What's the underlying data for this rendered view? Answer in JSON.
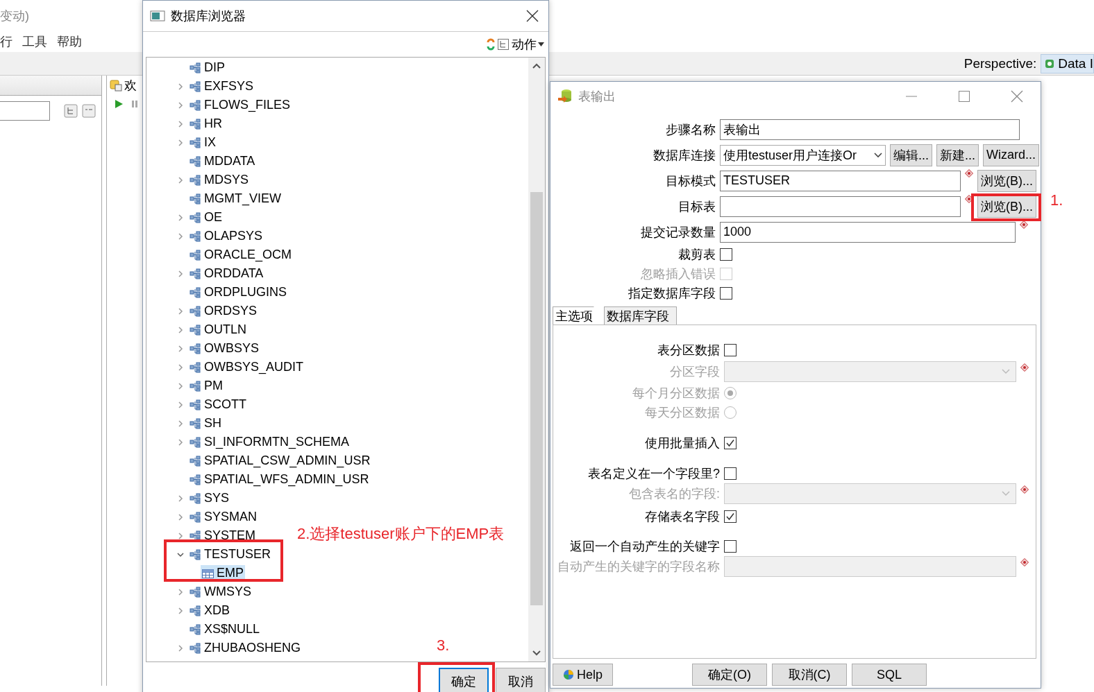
{
  "background_app": {
    "title": "变动)",
    "menu": [
      "行",
      "工具",
      "帮助"
    ],
    "perspective_label": "Perspective:",
    "perspective": "Data I",
    "welcome_tab": "欢"
  },
  "db_browser": {
    "title": "数据库浏览器",
    "action_menu": "动作",
    "tree": [
      {
        "label": "DIP",
        "kind": "schema",
        "expandable": false,
        "selected": false
      },
      {
        "label": "EXFSYS",
        "kind": "schema",
        "expandable": true,
        "expanded": false,
        "selected": false
      },
      {
        "label": "FLOWS_FILES",
        "kind": "schema",
        "expandable": true,
        "expanded": false,
        "selected": false
      },
      {
        "label": "HR",
        "kind": "schema",
        "expandable": true,
        "expanded": false,
        "selected": false
      },
      {
        "label": "IX",
        "kind": "schema",
        "expandable": true,
        "expanded": false,
        "selected": false
      },
      {
        "label": "MDDATA",
        "kind": "schema",
        "expandable": false,
        "selected": false
      },
      {
        "label": "MDSYS",
        "kind": "schema",
        "expandable": true,
        "expanded": false,
        "selected": false
      },
      {
        "label": "MGMT_VIEW",
        "kind": "schema",
        "expandable": false,
        "selected": false
      },
      {
        "label": "OE",
        "kind": "schema",
        "expandable": true,
        "expanded": false,
        "selected": false
      },
      {
        "label": "OLAPSYS",
        "kind": "schema",
        "expandable": true,
        "expanded": false,
        "selected": false
      },
      {
        "label": "ORACLE_OCM",
        "kind": "schema",
        "expandable": false,
        "selected": false
      },
      {
        "label": "ORDDATA",
        "kind": "schema",
        "expandable": true,
        "expanded": false,
        "selected": false
      },
      {
        "label": "ORDPLUGINS",
        "kind": "schema",
        "expandable": false,
        "selected": false
      },
      {
        "label": "ORDSYS",
        "kind": "schema",
        "expandable": true,
        "expanded": false,
        "selected": false
      },
      {
        "label": "OUTLN",
        "kind": "schema",
        "expandable": true,
        "expanded": false,
        "selected": false
      },
      {
        "label": "OWBSYS",
        "kind": "schema",
        "expandable": true,
        "expanded": false,
        "selected": false
      },
      {
        "label": "OWBSYS_AUDIT",
        "kind": "schema",
        "expandable": true,
        "expanded": false,
        "selected": false
      },
      {
        "label": "PM",
        "kind": "schema",
        "expandable": true,
        "expanded": false,
        "selected": false
      },
      {
        "label": "SCOTT",
        "kind": "schema",
        "expandable": true,
        "expanded": false,
        "selected": false
      },
      {
        "label": "SH",
        "kind": "schema",
        "expandable": true,
        "expanded": false,
        "selected": false
      },
      {
        "label": "SI_INFORMTN_SCHEMA",
        "kind": "schema",
        "expandable": true,
        "expanded": false,
        "selected": false
      },
      {
        "label": "SPATIAL_CSW_ADMIN_USR",
        "kind": "schema",
        "expandable": false,
        "selected": false
      },
      {
        "label": "SPATIAL_WFS_ADMIN_USR",
        "kind": "schema",
        "expandable": false,
        "selected": false
      },
      {
        "label": "SYS",
        "kind": "schema",
        "expandable": true,
        "expanded": false,
        "selected": false
      },
      {
        "label": "SYSMAN",
        "kind": "schema",
        "expandable": true,
        "expanded": false,
        "selected": false
      },
      {
        "label": "SYSTEM",
        "kind": "schema",
        "expandable": true,
        "expanded": false,
        "selected": false
      },
      {
        "label": "TESTUSER",
        "kind": "schema",
        "expandable": true,
        "expanded": true,
        "selected": false,
        "children": [
          {
            "label": "EMP",
            "kind": "table",
            "expandable": false,
            "selected": true
          }
        ]
      },
      {
        "label": "WMSYS",
        "kind": "schema",
        "expandable": true,
        "expanded": false,
        "selected": false
      },
      {
        "label": "XDB",
        "kind": "schema",
        "expandable": true,
        "expanded": false,
        "selected": false
      },
      {
        "label": "XS$NULL",
        "kind": "schema",
        "expandable": false,
        "selected": false
      },
      {
        "label": "ZHUBAOSHENG",
        "kind": "schema",
        "expandable": true,
        "expanded": false,
        "selected": false
      }
    ],
    "buttons": [
      "确定",
      "取消"
    ]
  },
  "table_output": {
    "title": "表输出",
    "fields": [
      {
        "kind": "text",
        "label": "步骤名称",
        "value": "表输出",
        "disabled": false
      },
      {
        "kind": "select",
        "label": "数据库连接",
        "value": "使用testuser用户连接Or",
        "buttons": [
          "编辑...",
          "新建...",
          "Wizard..."
        ]
      },
      {
        "kind": "text",
        "label": "目标模式",
        "value": "TESTUSER",
        "disabled": false,
        "marker": true,
        "buttons": [
          "浏览(B)..."
        ]
      },
      {
        "kind": "text",
        "label": "目标表",
        "disabled": false,
        "marker": true,
        "buttons": [
          "浏览(B)..."
        ]
      },
      {
        "kind": "text",
        "label": "提交记录数量",
        "value": "1000",
        "disabled": false,
        "marker": true
      },
      {
        "kind": "checkbox",
        "label": "裁剪表",
        "checked": false,
        "disabled": false
      },
      {
        "kind": "checkbox",
        "label": "忽略插入错误",
        "checked": false,
        "disabled": true
      },
      {
        "kind": "checkbox",
        "label": "指定数据库字段",
        "checked": false,
        "disabled": false
      }
    ],
    "tabs": [
      {
        "label": "主选项",
        "selected": true
      },
      {
        "label": "数据库字段",
        "selected": false
      }
    ],
    "options": [
      {
        "kind": "checkbox",
        "label": "表分区数据",
        "checked": false,
        "disabled": false
      },
      {
        "kind": "combo",
        "label": "分区字段",
        "disabled": true,
        "marker": true
      },
      {
        "kind": "radio",
        "label": "每个月分区数据",
        "selected": true,
        "disabled": true
      },
      {
        "kind": "radio",
        "label": "每天分区数据",
        "selected": false,
        "disabled": true
      },
      {
        "kind": "checkbox",
        "label": "使用批量插入",
        "checked": true,
        "disabled": false
      },
      {
        "kind": "checkbox",
        "label": "表名定义在一个字段里?",
        "checked": false,
        "disabled": false
      },
      {
        "kind": "combo",
        "label": "包含表名的字段:",
        "disabled": true,
        "marker": true
      },
      {
        "kind": "checkbox",
        "label": "存储表名字段",
        "checked": true,
        "disabled": false
      },
      {
        "kind": "checkbox",
        "label": "返回一个自动产生的关键字",
        "checked": false,
        "disabled": false
      },
      {
        "kind": "text",
        "label": "自动产生的关键字的字段名称",
        "disabled": true,
        "marker": true
      }
    ],
    "buttons": [
      {
        "label": "Help",
        "kind": "help"
      },
      {
        "label": "确定(O)",
        "kind": "plain"
      },
      {
        "label": "取消(C)",
        "kind": "plain"
      },
      {
        "label": "SQL",
        "kind": "plain"
      }
    ]
  },
  "annotations": [
    {
      "text": "1."
    },
    {
      "text": "2.选择testuser账户下的EMP表"
    },
    {
      "text": "3."
    }
  ]
}
